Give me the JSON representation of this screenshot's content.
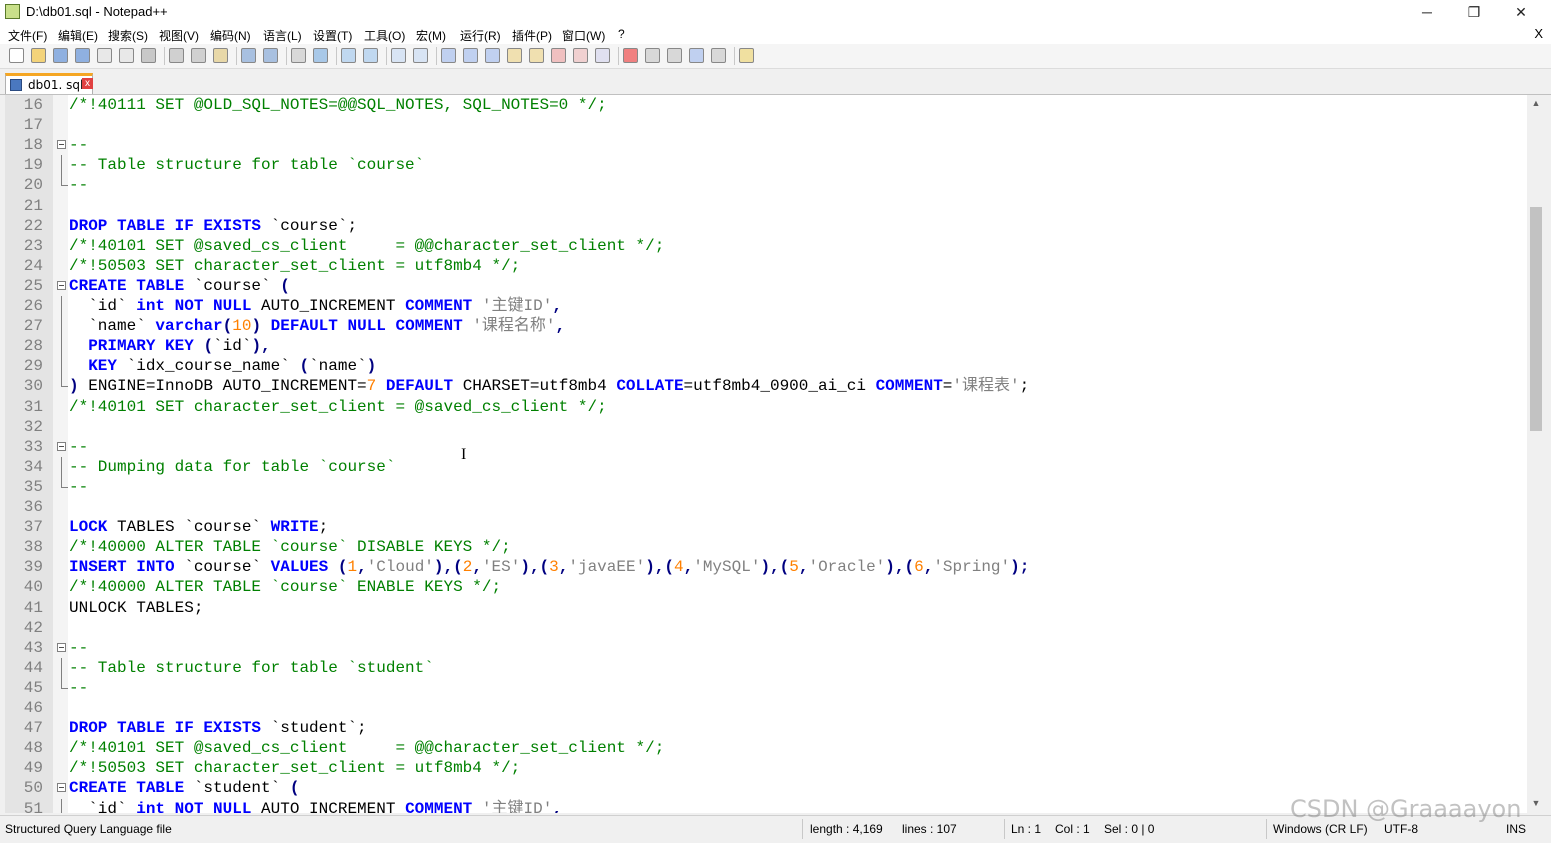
{
  "window": {
    "title": "D:\\db01.sql - Notepad++",
    "minimize": "─",
    "restore": "❐",
    "close": "✕"
  },
  "menu": {
    "items": [
      "文件(F)",
      "编辑(E)",
      "搜索(S)",
      "视图(V)",
      "编码(N)",
      "语言(L)",
      "设置(T)",
      "工具(O)",
      "宏(M)",
      "运行(R)",
      "插件(P)",
      "窗口(W)",
      "?"
    ],
    "close_doc": "X"
  },
  "toolbar": {
    "icons": [
      "new-file-icon",
      "open-file-icon",
      "save-icon",
      "save-all-icon",
      "close-icon",
      "close-all-icon",
      "print-icon",
      "cut-icon",
      "copy-icon",
      "paste-icon",
      "undo-icon",
      "redo-icon",
      "find-icon",
      "replace-icon",
      "zoom-in-icon",
      "zoom-out-icon",
      "sync-vertical-icon",
      "sync-horizontal-icon",
      "word-wrap-icon",
      "show-all-chars-icon",
      "indent-guide-icon",
      "user-language-icon",
      "doc-map-icon",
      "function-list-icon",
      "folder-as-workspace-icon",
      "monitor-icon",
      "record-macro-icon",
      "stop-record-icon",
      "play-macro-icon",
      "run-macro-multiple-icon",
      "save-macro-icon",
      "plugin-icon"
    ]
  },
  "tab": {
    "label": "db01. sql",
    "close": "x"
  },
  "editor": {
    "lines": [
      {
        "n": "16",
        "fold": "",
        "toks": [
          [
            "c",
            "/*!40111 SET @OLD_SQL_NOTES=@@SQL_NOTES, SQL_NOTES=0 */;"
          ]
        ]
      },
      {
        "n": "17",
        "fold": "",
        "toks": []
      },
      {
        "n": "18",
        "fold": "start",
        "toks": [
          [
            "c",
            "--"
          ]
        ]
      },
      {
        "n": "19",
        "fold": "mid",
        "toks": [
          [
            "c",
            "-- Table structure for table `course`"
          ]
        ]
      },
      {
        "n": "20",
        "fold": "end",
        "toks": [
          [
            "c",
            "--"
          ]
        ]
      },
      {
        "n": "21",
        "fold": "",
        "toks": []
      },
      {
        "n": "22",
        "fold": "",
        "toks": [
          [
            "k",
            "DROP TABLE IF EXISTS"
          ],
          [
            "p",
            " `course`;"
          ]
        ]
      },
      {
        "n": "23",
        "fold": "",
        "toks": [
          [
            "c",
            "/*!40101 SET @saved_cs_client     = @@character_set_client */;"
          ]
        ]
      },
      {
        "n": "24",
        "fold": "",
        "toks": [
          [
            "c",
            "/*!50503 SET character_set_client = utf8mb4 */;"
          ]
        ]
      },
      {
        "n": "25",
        "fold": "start",
        "toks": [
          [
            "k",
            "CREATE TABLE"
          ],
          [
            "p",
            " `course` "
          ],
          [
            "o",
            "("
          ]
        ]
      },
      {
        "n": "26",
        "fold": "mid",
        "toks": [
          [
            "p",
            "  `id` "
          ],
          [
            "k",
            "int NOT NULL"
          ],
          [
            "p",
            " AUTO_INCREMENT "
          ],
          [
            "k",
            "COMMENT"
          ],
          [
            "p",
            " "
          ],
          [
            "s",
            "'主键ID'"
          ],
          [
            "o",
            ","
          ]
        ]
      },
      {
        "n": "27",
        "fold": "mid",
        "toks": [
          [
            "p",
            "  `name` "
          ],
          [
            "k",
            "varchar"
          ],
          [
            "o",
            "("
          ],
          [
            "n",
            "10"
          ],
          [
            "o",
            ")"
          ],
          [
            "p",
            " "
          ],
          [
            "k",
            "DEFAULT NULL COMMENT"
          ],
          [
            "p",
            " "
          ],
          [
            "s",
            "'课程名称'"
          ],
          [
            "o",
            ","
          ]
        ]
      },
      {
        "n": "28",
        "fold": "mid",
        "toks": [
          [
            "p",
            "  "
          ],
          [
            "k",
            "PRIMARY KEY"
          ],
          [
            "p",
            " "
          ],
          [
            "o",
            "("
          ],
          [
            "p",
            "`id`"
          ],
          [
            "o",
            "),"
          ]
        ]
      },
      {
        "n": "29",
        "fold": "mid",
        "toks": [
          [
            "p",
            "  "
          ],
          [
            "k",
            "KEY"
          ],
          [
            "p",
            " `idx_course_name` "
          ],
          [
            "o",
            "("
          ],
          [
            "p",
            "`name`"
          ],
          [
            "o",
            ")"
          ]
        ]
      },
      {
        "n": "30",
        "fold": "end",
        "toks": [
          [
            "o",
            ")"
          ],
          [
            "p",
            " ENGINE=InnoDB AUTO_INCREMENT="
          ],
          [
            "n",
            "7"
          ],
          [
            "p",
            " "
          ],
          [
            "k",
            "DEFAULT"
          ],
          [
            "p",
            " CHARSET=utf8mb4 "
          ],
          [
            "k",
            "COLLATE"
          ],
          [
            "p",
            "=utf8mb4_0900_ai_ci "
          ],
          [
            "k",
            "COMMENT"
          ],
          [
            "p",
            "="
          ],
          [
            "s",
            "'课程表'"
          ],
          [
            "p",
            ";"
          ]
        ]
      },
      {
        "n": "31",
        "fold": "",
        "toks": [
          [
            "c",
            "/*!40101 SET character_set_client = @saved_cs_client */;"
          ]
        ]
      },
      {
        "n": "32",
        "fold": "",
        "toks": []
      },
      {
        "n": "33",
        "fold": "start",
        "toks": [
          [
            "c",
            "--"
          ]
        ]
      },
      {
        "n": "34",
        "fold": "mid",
        "toks": [
          [
            "c",
            "-- Dumping data for table `course`"
          ]
        ]
      },
      {
        "n": "35",
        "fold": "end",
        "toks": [
          [
            "c",
            "--"
          ]
        ]
      },
      {
        "n": "36",
        "fold": "",
        "toks": []
      },
      {
        "n": "37",
        "fold": "",
        "toks": [
          [
            "k",
            "LOCK"
          ],
          [
            "p",
            " TABLES `course` "
          ],
          [
            "k",
            "WRITE"
          ],
          [
            "p",
            ";"
          ]
        ]
      },
      {
        "n": "38",
        "fold": "",
        "toks": [
          [
            "c",
            "/*!40000 ALTER TABLE `course` DISABLE KEYS */;"
          ]
        ]
      },
      {
        "n": "39",
        "fold": "",
        "toks": [
          [
            "k",
            "INSERT INTO"
          ],
          [
            "p",
            " `course` "
          ],
          [
            "k",
            "VALUES"
          ],
          [
            "p",
            " "
          ],
          [
            "o",
            "("
          ],
          [
            "n",
            "1"
          ],
          [
            "o",
            ","
          ],
          [
            "s",
            "'Cloud'"
          ],
          [
            "o",
            "),("
          ],
          [
            "n",
            "2"
          ],
          [
            "o",
            ","
          ],
          [
            "s",
            "'ES'"
          ],
          [
            "o",
            "),("
          ],
          [
            "n",
            "3"
          ],
          [
            "o",
            ","
          ],
          [
            "s",
            "'javaEE'"
          ],
          [
            "o",
            "),("
          ],
          [
            "n",
            "4"
          ],
          [
            "o",
            ","
          ],
          [
            "s",
            "'MySQL'"
          ],
          [
            "o",
            "),("
          ],
          [
            "n",
            "5"
          ],
          [
            "o",
            ","
          ],
          [
            "s",
            "'Oracle'"
          ],
          [
            "o",
            "),("
          ],
          [
            "n",
            "6"
          ],
          [
            "o",
            ","
          ],
          [
            "s",
            "'Spring'"
          ],
          [
            "o",
            ");"
          ]
        ]
      },
      {
        "n": "40",
        "fold": "",
        "toks": [
          [
            "c",
            "/*!40000 ALTER TABLE `course` ENABLE KEYS */;"
          ]
        ]
      },
      {
        "n": "41",
        "fold": "",
        "toks": [
          [
            "p",
            "UNLOCK TABLES;"
          ]
        ]
      },
      {
        "n": "42",
        "fold": "",
        "toks": []
      },
      {
        "n": "43",
        "fold": "start",
        "toks": [
          [
            "c",
            "--"
          ]
        ]
      },
      {
        "n": "44",
        "fold": "mid",
        "toks": [
          [
            "c",
            "-- Table structure for table `student`"
          ]
        ]
      },
      {
        "n": "45",
        "fold": "end",
        "toks": [
          [
            "c",
            "--"
          ]
        ]
      },
      {
        "n": "46",
        "fold": "",
        "toks": []
      },
      {
        "n": "47",
        "fold": "",
        "toks": [
          [
            "k",
            "DROP TABLE IF EXISTS"
          ],
          [
            "p",
            " `student`;"
          ]
        ]
      },
      {
        "n": "48",
        "fold": "",
        "toks": [
          [
            "c",
            "/*!40101 SET @saved_cs_client     = @@character_set_client */;"
          ]
        ]
      },
      {
        "n": "49",
        "fold": "",
        "toks": [
          [
            "c",
            "/*!50503 SET character_set_client = utf8mb4 */;"
          ]
        ]
      },
      {
        "n": "50",
        "fold": "start",
        "toks": [
          [
            "k",
            "CREATE TABLE"
          ],
          [
            "p",
            " `student` "
          ],
          [
            "o",
            "("
          ]
        ]
      },
      {
        "n": "51",
        "fold": "mid",
        "toks": [
          [
            "p",
            "  `id` "
          ],
          [
            "k",
            "int NOT NULL"
          ],
          [
            "p",
            " AUTO_INCREMENT "
          ],
          [
            "k",
            "COMMENT"
          ],
          [
            "p",
            " "
          ],
          [
            "s",
            "'主键ID'"
          ],
          [
            "o",
            ","
          ]
        ]
      }
    ]
  },
  "status": {
    "language": "Structured Query Language file",
    "length": "length : 4,169",
    "lines": "lines : 107",
    "ln": "Ln : 1",
    "col": "Col : 1",
    "sel": "Sel : 0 | 0",
    "eol": "Windows (CR LF)",
    "encoding": "UTF-8",
    "mode": "INS"
  },
  "watermark": "CSDN @Graaaayon",
  "colors": {
    "comment": "#008000",
    "keyword": "#0000ff",
    "string": "#808080",
    "number": "#ff8000",
    "operator": "#000080",
    "tab_accent": "#f5a623"
  }
}
